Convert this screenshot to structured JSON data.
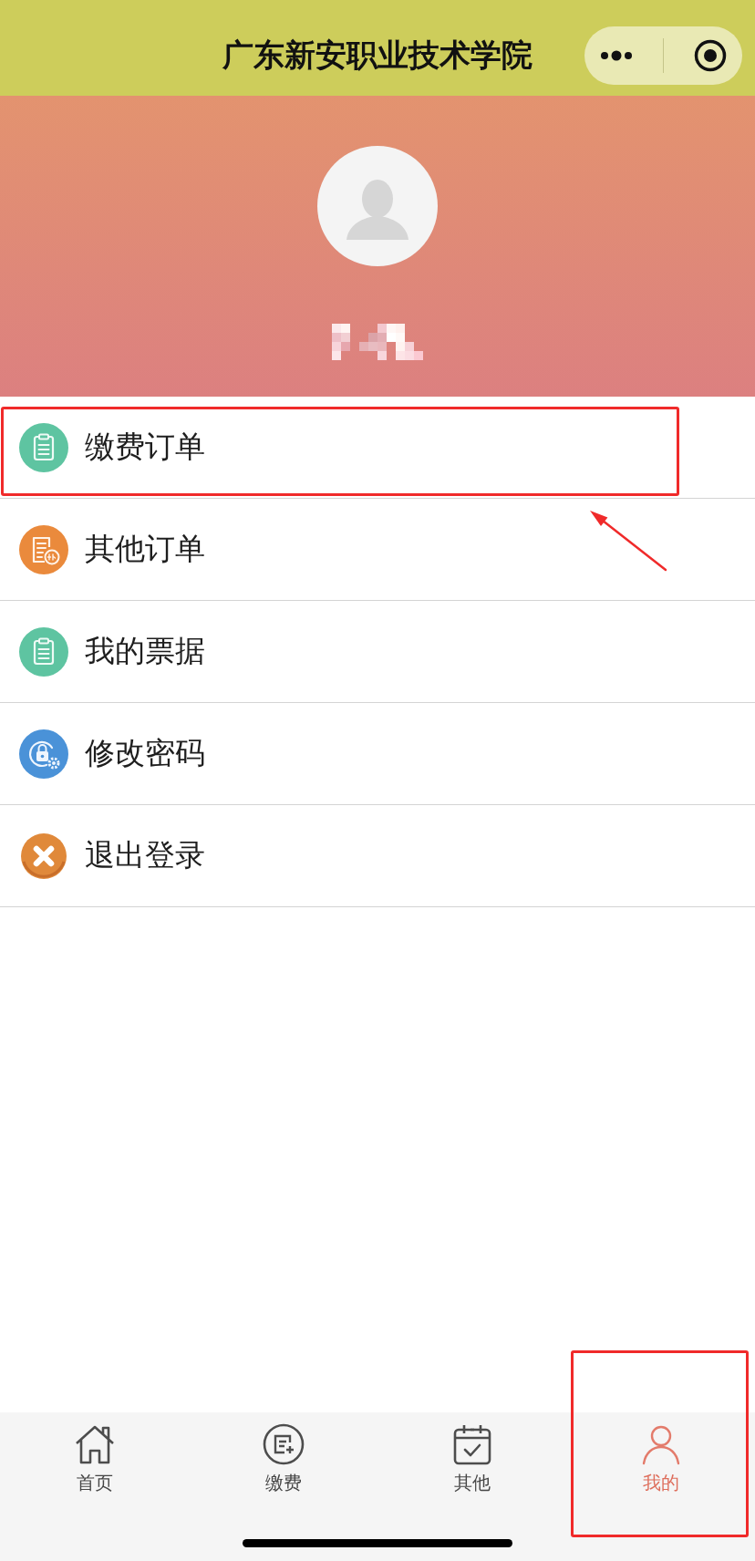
{
  "nav_bar": {
    "title": "广东新安职业技术学院"
  },
  "menu": [
    {
      "label": "缴费订单",
      "kind": "clipboard",
      "color": "#5ec4a1",
      "annotated": true
    },
    {
      "label": "其他订单",
      "kind": "document",
      "color": "#ea8a3c",
      "annotated": false
    },
    {
      "label": "我的票据",
      "kind": "clipboard",
      "color": "#5ec4a1",
      "annotated": false
    },
    {
      "label": "修改密码",
      "kind": "lock",
      "color": "#4a92d8",
      "annotated": false
    },
    {
      "label": "退出登录",
      "kind": "close",
      "color": "#e0893a",
      "annotated": false
    }
  ],
  "tab_bar": [
    {
      "label": "首页",
      "kind": "home",
      "selected": false,
      "annotated": false
    },
    {
      "label": "缴费",
      "kind": "pay",
      "selected": false,
      "annotated": false
    },
    {
      "label": "其他",
      "kind": "calendar",
      "selected": false,
      "annotated": false
    },
    {
      "label": "我的",
      "kind": "person",
      "selected": true,
      "annotated": true
    }
  ]
}
